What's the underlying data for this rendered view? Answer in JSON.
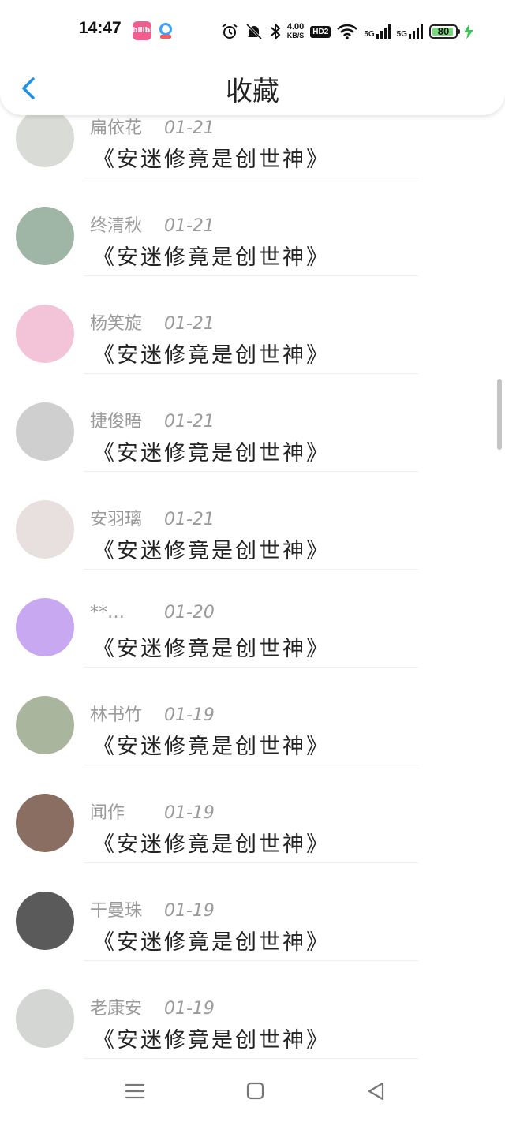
{
  "status": {
    "time": "14:47",
    "net_speed_value": "4.00",
    "net_speed_unit": "KB/S",
    "hd_badge": "HD2",
    "network1": "5G",
    "network2": "5G",
    "battery": "80",
    "bili_label": "bilibili"
  },
  "header": {
    "title": "收藏"
  },
  "items": [
    {
      "name": "扁依花",
      "date": "01-21",
      "content": "《安迷修竟是创世神》",
      "avatar_color": "#d9dcd6"
    },
    {
      "name": "终清秋",
      "date": "01-21",
      "content": "《安迷修竟是创世神》",
      "avatar_color": "#9fb6a6"
    },
    {
      "name": "杨笑旋",
      "date": "01-21",
      "content": "《安迷修竟是创世神》",
      "avatar_color": "#f3c4d8"
    },
    {
      "name": "捷俊晤",
      "date": "01-21",
      "content": "《安迷修竟是创世神》",
      "avatar_color": "#cfcfcf"
    },
    {
      "name": "安羽璃",
      "date": "01-21",
      "content": "《安迷修竟是创世神》",
      "avatar_color": "#e8e0de"
    },
    {
      "name": "**…",
      "date": "01-20",
      "content": "《安迷修竟是创世神》",
      "avatar_color": "#c9a8f2"
    },
    {
      "name": "林书竹",
      "date": "01-19",
      "content": "《安迷修竟是创世神》",
      "avatar_color": "#a9b69d"
    },
    {
      "name": "闻作",
      "date": "01-19",
      "content": "《安迷修竟是创世神》",
      "avatar_color": "#8a6e62"
    },
    {
      "name": "干曼珠",
      "date": "01-19",
      "content": "《安迷修竟是创世神》",
      "avatar_color": "#5a5a5a"
    },
    {
      "name": "老康安",
      "date": "01-19",
      "content": "《安迷修竟是创世神》",
      "avatar_color": "#d4d6d3"
    }
  ],
  "colors": {
    "accent": "#1e90e8",
    "meta_text": "#9a9a9a",
    "battery_fill": "#7cd67c",
    "charging": "#3fbf5a"
  },
  "nav": {
    "icons": [
      "menu-icon",
      "home-icon",
      "back-triangle-icon"
    ]
  }
}
